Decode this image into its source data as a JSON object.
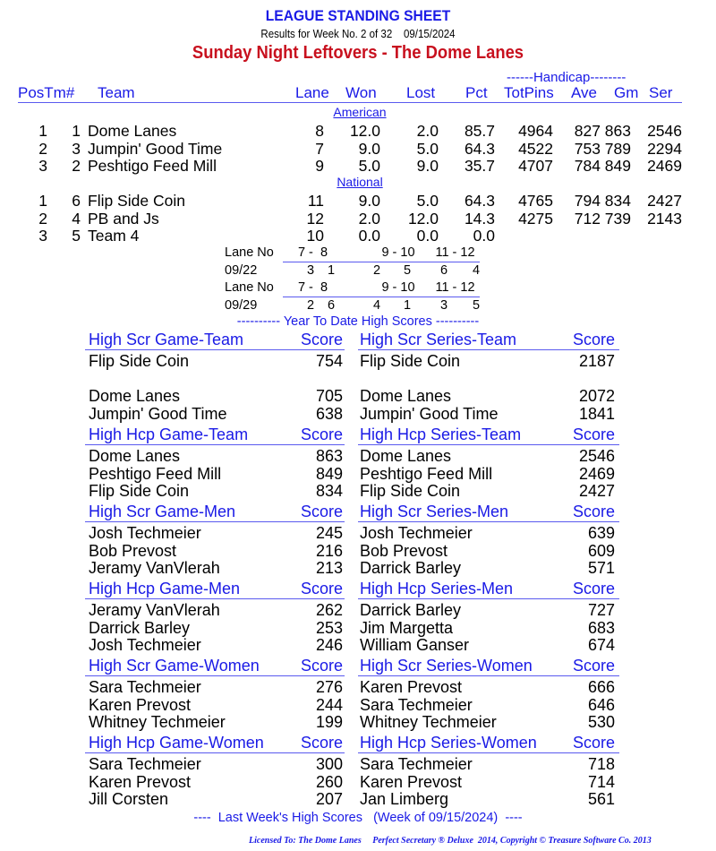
{
  "header": {
    "title": "LEAGUE STANDING SHEET",
    "subtitle": "Results for Week No. 2 of 32    09/15/2024",
    "league_name": "Sunday Night Leftovers - The Dome Lanes",
    "handicap_label": "------Handicap--------"
  },
  "columns": {
    "pos_tm": "PosTm#",
    "team": "Team",
    "lane": "Lane",
    "won": "Won",
    "lost": "Lost",
    "pct": "Pct",
    "totpins": "TotPins",
    "ave": "Ave",
    "gm": "Gm",
    "ser": "Ser"
  },
  "divisions": [
    {
      "name": "American",
      "teams": [
        {
          "pos": "1",
          "tm": "1",
          "team": "Dome Lanes",
          "lane": "8",
          "won": "12.0",
          "lost": "2.0",
          "pct": "85.7",
          "totpins": "4964",
          "ave": "827",
          "gm": "863",
          "ser": "2546"
        },
        {
          "pos": "2",
          "tm": "3",
          "team": "Jumpin' Good Time",
          "lane": "7",
          "won": "9.0",
          "lost": "5.0",
          "pct": "64.3",
          "totpins": "4522",
          "ave": "753",
          "gm": "789",
          "ser": "2294"
        },
        {
          "pos": "3",
          "tm": "2",
          "team": "Peshtigo Feed Mill",
          "lane": "9",
          "won": "5.0",
          "lost": "9.0",
          "pct": "35.7",
          "totpins": "4707",
          "ave": "784",
          "gm": "849",
          "ser": "2469"
        }
      ]
    },
    {
      "name": "National",
      "teams": [
        {
          "pos": "1",
          "tm": "6",
          "team": "Flip Side Coin",
          "lane": "11",
          "won": "9.0",
          "lost": "5.0",
          "pct": "64.3",
          "totpins": "4765",
          "ave": "794",
          "gm": "834",
          "ser": "2427"
        },
        {
          "pos": "2",
          "tm": "4",
          "team": "PB and Js",
          "lane": "12",
          "won": "2.0",
          "lost": "12.0",
          "pct": "14.3",
          "totpins": "4275",
          "ave": "712",
          "gm": "739",
          "ser": "2143"
        },
        {
          "pos": "3",
          "tm": "5",
          "team": "Team 4",
          "lane": "10",
          "won": "0.0",
          "lost": "0.0",
          "pct": "0.0",
          "totpins": "",
          "ave": "",
          "gm": "",
          "ser": ""
        }
      ]
    }
  ],
  "lane_schedule": [
    {
      "label": "Lane No",
      "pairs": [
        "7 -  8",
        "9 - 10",
        "11 - 12"
      ],
      "date": "09/22",
      "matchups": [
        [
          "3",
          "1"
        ],
        [
          "2",
          "5"
        ],
        [
          "6",
          "4"
        ]
      ]
    },
    {
      "label": "Lane No",
      "pairs": [
        "7 -  8",
        "9 - 10",
        "11 - 12"
      ],
      "date": "09/29",
      "matchups": [
        [
          "2",
          "6"
        ],
        [
          "4",
          "1"
        ],
        [
          "3",
          "5"
        ]
      ]
    }
  ],
  "ytd_title": "---------- Year To Date High Scores ----------",
  "high_scores": [
    {
      "left": {
        "title": "High Scr Game-Team",
        "score_label": "Score",
        "entries": [
          [
            "Flip Side Coin",
            "754"
          ],
          [
            "",
            ""
          ],
          [
            "Dome Lanes",
            "705"
          ],
          [
            "Jumpin' Good Time",
            "638"
          ]
        ]
      },
      "right": {
        "title": "High Scr Series-Team",
        "score_label": "Score",
        "entries": [
          [
            "Flip Side Coin",
            "2187"
          ],
          [
            "",
            ""
          ],
          [
            "Dome Lanes",
            "2072"
          ],
          [
            "Jumpin' Good Time",
            "1841"
          ]
        ]
      }
    },
    {
      "left": {
        "title": "High Hcp Game-Team",
        "score_label": "Score",
        "entries": [
          [
            "Dome Lanes",
            "863"
          ],
          [
            "Peshtigo Feed Mill",
            "849"
          ],
          [
            "Flip Side Coin",
            "834"
          ]
        ]
      },
      "right": {
        "title": "High Hcp Series-Team",
        "score_label": "Score",
        "entries": [
          [
            "Dome Lanes",
            "2546"
          ],
          [
            "Peshtigo Feed Mill",
            "2469"
          ],
          [
            "Flip Side Coin",
            "2427"
          ]
        ]
      }
    },
    {
      "left": {
        "title": "High Scr Game-Men",
        "score_label": "Score",
        "entries": [
          [
            "Josh Techmeier",
            "245"
          ],
          [
            "Bob Prevost",
            "216"
          ],
          [
            "Jeramy VanVlerah",
            "213"
          ]
        ]
      },
      "right": {
        "title": "High Scr Series-Men",
        "score_label": "Score",
        "entries": [
          [
            "Josh Techmeier",
            "639"
          ],
          [
            "Bob Prevost",
            "609"
          ],
          [
            "Darrick Barley",
            "571"
          ]
        ]
      }
    },
    {
      "left": {
        "title": "High Hcp Game-Men",
        "score_label": "Score",
        "entries": [
          [
            "Jeramy VanVlerah",
            "262"
          ],
          [
            "Darrick Barley",
            "253"
          ],
          [
            "Josh Techmeier",
            "246"
          ]
        ]
      },
      "right": {
        "title": "High Hcp Series-Men",
        "score_label": "Score",
        "entries": [
          [
            "Darrick Barley",
            "727"
          ],
          [
            "Jim Margetta",
            "683"
          ],
          [
            "William Ganser",
            "674"
          ]
        ]
      }
    },
    {
      "left": {
        "title": "High Scr Game-Women",
        "score_label": "Score",
        "entries": [
          [
            "Sara Techmeier",
            "276"
          ],
          [
            "Karen Prevost",
            "244"
          ],
          [
            "Whitney Techmeier",
            "199"
          ]
        ]
      },
      "right": {
        "title": "High Scr Series-Women",
        "score_label": "Score",
        "entries": [
          [
            "Karen Prevost",
            "666"
          ],
          [
            "Sara Techmeier",
            "646"
          ],
          [
            "Whitney Techmeier",
            "530"
          ]
        ]
      }
    },
    {
      "left": {
        "title": "High Hcp Game-Women",
        "score_label": "Score",
        "entries": [
          [
            "Sara Techmeier",
            "300"
          ],
          [
            "Karen Prevost",
            "260"
          ],
          [
            "Jill Corsten",
            "207"
          ]
        ]
      },
      "right": {
        "title": "High Hcp Series-Women",
        "score_label": "Score",
        "entries": [
          [
            "Sara Techmeier",
            "718"
          ],
          [
            "Karen Prevost",
            "714"
          ],
          [
            "Jan Limberg",
            "561"
          ]
        ]
      }
    }
  ],
  "last_week_title": "----  Last Week's High Scores   (Week of 09/15/2024)  ----",
  "footer": "Licensed To: The Dome Lanes     Perfect Secretary ® Deluxe  2014, Copyright © Treasure Software Co. 2013"
}
